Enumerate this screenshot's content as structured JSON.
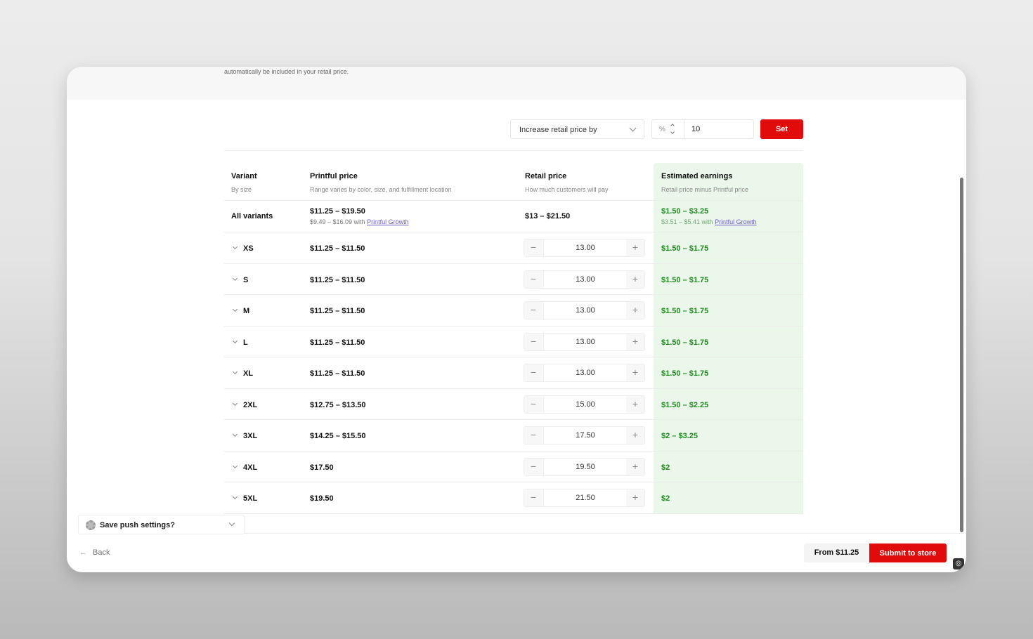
{
  "top_note": "automatically be included in your retail price.",
  "controls": {
    "mode_select": "Increase retail price by",
    "unit": "%",
    "amount": "10",
    "set_label": "Set"
  },
  "table": {
    "headers": {
      "variant": {
        "title": "Variant",
        "sub": "By size"
      },
      "printful": {
        "title": "Printful price",
        "sub": "Range varies by color, size, and fulfillment location"
      },
      "retail": {
        "title": "Retail price",
        "sub": "How much customers will pay"
      },
      "earnings": {
        "title": "Estimated earnings",
        "sub": "Retail price minus Printful price"
      }
    },
    "all_variants": {
      "label": "All variants",
      "printful": "$11.25 – $19.50",
      "printful_growth_prefix": "$9.49 – $16.09 with ",
      "printful_growth_link": "Printful Growth",
      "retail": "$13 – $21.50",
      "earnings": "$1.50 – $3.25",
      "earnings_growth_prefix": "$3.51 – $5.41 with ",
      "earnings_growth_link": "Printful Growth"
    },
    "rows": [
      {
        "size": "XS",
        "printful": "$11.25 – $11.50",
        "retail": "13.00",
        "earnings": "$1.50 – $1.75"
      },
      {
        "size": "S",
        "printful": "$11.25 – $11.50",
        "retail": "13.00",
        "earnings": "$1.50 – $1.75"
      },
      {
        "size": "M",
        "printful": "$11.25 – $11.50",
        "retail": "13.00",
        "earnings": "$1.50 – $1.75"
      },
      {
        "size": "L",
        "printful": "$11.25 – $11.50",
        "retail": "13.00",
        "earnings": "$1.50 – $1.75"
      },
      {
        "size": "XL",
        "printful": "$11.25 – $11.50",
        "retail": "13.00",
        "earnings": "$1.50 – $1.75"
      },
      {
        "size": "2XL",
        "printful": "$12.75 – $13.50",
        "retail": "15.00",
        "earnings": "$1.50 – $2.25"
      },
      {
        "size": "3XL",
        "printful": "$14.25 – $15.50",
        "retail": "17.50",
        "earnings": "$2 – $3.25"
      },
      {
        "size": "4XL",
        "printful": "$17.50",
        "retail": "19.50",
        "earnings": "$2"
      },
      {
        "size": "5XL",
        "printful": "$19.50",
        "retail": "21.50",
        "earnings": "$2"
      }
    ],
    "stepper_minus": "−",
    "stepper_plus": "+"
  },
  "footer": {
    "save_push": "Save push settings?",
    "back": "Back",
    "back_arrow": "←",
    "from_price": "From $11.25",
    "submit": "Submit to store"
  },
  "colors": {
    "accent": "#e20b0b",
    "earnings_green": "#1c8a1c",
    "earnings_bg": "#ecf7ec"
  }
}
